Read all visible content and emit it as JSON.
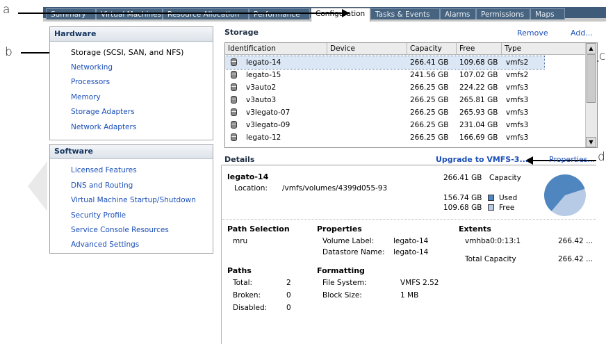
{
  "tabs": [
    {
      "label": "Summary"
    },
    {
      "label": "Virtual Machines"
    },
    {
      "label": "Resource Allocation"
    },
    {
      "label": "Performance"
    },
    {
      "label": "Configuration"
    },
    {
      "label": "Tasks & Events"
    },
    {
      "label": "Alarms"
    },
    {
      "label": "Permissions"
    },
    {
      "label": "Maps"
    }
  ],
  "annotations": {
    "a": "a",
    "b": "b",
    "c": "c",
    "d": "d"
  },
  "hardware": {
    "title": "Hardware",
    "items": [
      "Storage (SCSI, SAN, and NFS)",
      "Networking",
      "Processors",
      "Memory",
      "Storage Adapters",
      "Network Adapters"
    ]
  },
  "software": {
    "title": "Software",
    "items": [
      "Licensed Features",
      "DNS and Routing",
      "Virtual Machine Startup/Shutdown",
      "Security Profile",
      "Service Console Resources",
      "Advanced Settings"
    ]
  },
  "storage": {
    "title": "Storage",
    "remove": "Remove",
    "add": "Add...",
    "columns": [
      "Identification",
      "Device",
      "Capacity",
      "Free",
      "Type"
    ],
    "rows": [
      {
        "id": "legato-14",
        "device": "",
        "capacity": "266.41 GB",
        "free": "109.68 GB",
        "type": "vmfs2"
      },
      {
        "id": "legato-15",
        "device": "",
        "capacity": "241.56 GB",
        "free": "107.02 GB",
        "type": "vmfs2"
      },
      {
        "id": "v3auto2",
        "device": "",
        "capacity": "266.25 GB",
        "free": "224.22 GB",
        "type": "vmfs3"
      },
      {
        "id": "v3auto3",
        "device": "",
        "capacity": "266.25 GB",
        "free": "265.81 GB",
        "type": "vmfs3"
      },
      {
        "id": "v3legato-07",
        "device": "",
        "capacity": "266.25 GB",
        "free": "265.93 GB",
        "type": "vmfs3"
      },
      {
        "id": "v3legato-09",
        "device": "",
        "capacity": "266.25 GB",
        "free": "231.04 GB",
        "type": "vmfs3"
      },
      {
        "id": "legato-12",
        "device": "",
        "capacity": "266.25 GB",
        "free": "166.69 GB",
        "type": "vmfs3"
      }
    ]
  },
  "details": {
    "title": "Details",
    "upgrade": "Upgrade to VMFS-3...",
    "properties": "Properties...",
    "name": "legato-14",
    "location_label": "Location:",
    "location": "/vmfs/volumes/4399d055-93",
    "capacity": "266.41 GB",
    "capacity_label": "Capacity",
    "used": "156.74 GB",
    "used_label": "Used",
    "free": "109.68 GB",
    "free_label": "Free",
    "used_fraction": 0.588,
    "colors": {
      "used": "#4f86bf",
      "free": "#b8cbe6"
    },
    "path_selection_title": "Path Selection",
    "path_selection": "mru",
    "properties_title": "Properties",
    "volume_label_label": "Volume Label:",
    "volume_label": "legato-14",
    "datastore_name_label": "Datastore Name:",
    "datastore_name": "legato-14",
    "extents_title": "Extents",
    "extent_name": "vmhba0:0:13:1",
    "extent_size": "266.42 ...",
    "total_capacity_label": "Total Capacity",
    "total_capacity": "266.42 ...",
    "paths_title": "Paths",
    "total_label": "Total:",
    "total": "2",
    "broken_label": "Broken:",
    "broken": "0",
    "disabled_label": "Disabled:",
    "disabled": "0",
    "formatting_title": "Formatting",
    "fs_label": "File System:",
    "fs": "VMFS 2.52",
    "block_label": "Block Size:",
    "block": "1 MB"
  }
}
